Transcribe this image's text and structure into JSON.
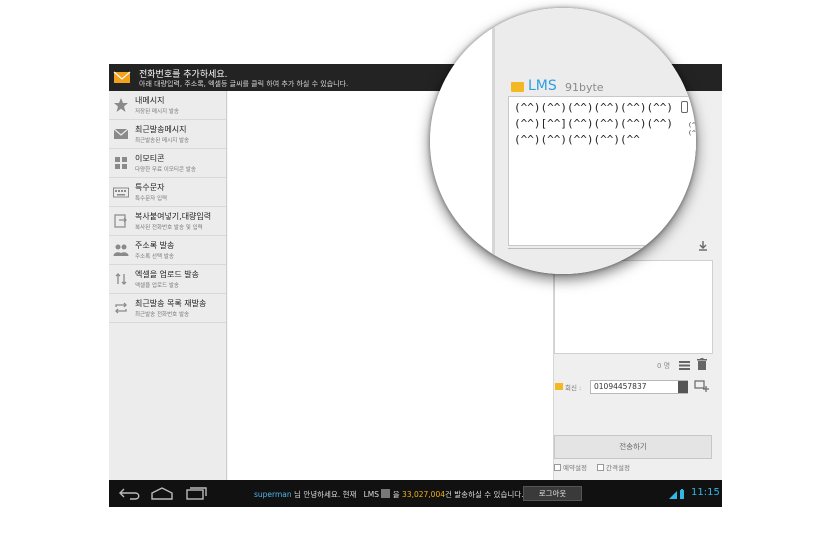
{
  "header": {
    "title": "전화번호를 추가하세요.",
    "subtitle": "아래 대량입력, 주소록, 엑셀등 글씨를 클릭 하여 추가 하실 수 있습니다."
  },
  "sidebar": {
    "items": [
      {
        "label": "내메시지",
        "sub": "저장된 메시지 발송",
        "icon": "star-icon"
      },
      {
        "label": "최근발송메시지",
        "sub": "최근발송된 메시지 발송",
        "icon": "envelope-icon"
      },
      {
        "label": "이모티콘",
        "sub": "다양한 무료 이모티콘 발송",
        "icon": "grid-icon"
      },
      {
        "label": "특수문자",
        "sub": "특수문자 입력",
        "icon": "keyboard-icon"
      },
      {
        "label": "복사붙여넣기,대량입력",
        "sub": "복사된 전화번호 발송 및 입력",
        "icon": "paste-icon"
      },
      {
        "label": "주소록 발송",
        "sub": "주소록 선택 발송",
        "icon": "people-icon"
      },
      {
        "label": "엑셀을 업로드 발송",
        "sub": "엑셀을 업로드 발송",
        "icon": "upload-icon"
      },
      {
        "label": "최근발송 목록 재발송",
        "sub": "최근발송 전화번호 발송",
        "icon": "repeat-icon"
      }
    ]
  },
  "compose": {
    "mode": "LMS",
    "bytes": "91byte",
    "message_lines": [
      "(^^)(^^)(^^)(^^)(^^)(^^)",
      "(^^)[^^](^^)(^^)(^^)(^^)",
      "(^^)(^^)(^^)(^^)(^^"
    ],
    "overflow_text": "(^^)\n(^^)",
    "count": "0 명",
    "reply_label": "회신 :",
    "reply_number": "01094457837",
    "send_label": "전송하기",
    "reserve_label": "예약설정",
    "interval_label": "간격설정"
  },
  "navbar": {
    "user": "superman",
    "greeting": " 님 안녕하세요. 현재",
    "type_value": "LMS",
    "count_prefix": " 을 ",
    "count_value": "33,027,004",
    "count_suffix": "건 발송하실 수 있습니다.",
    "logout_label": "로그아웃",
    "clock": "11:15"
  },
  "colors": {
    "accent_blue": "#33b5e5",
    "lms_blue": "#2d9fe0",
    "folder_yellow": "#f5b825",
    "count_orange": "#f0b21a"
  }
}
